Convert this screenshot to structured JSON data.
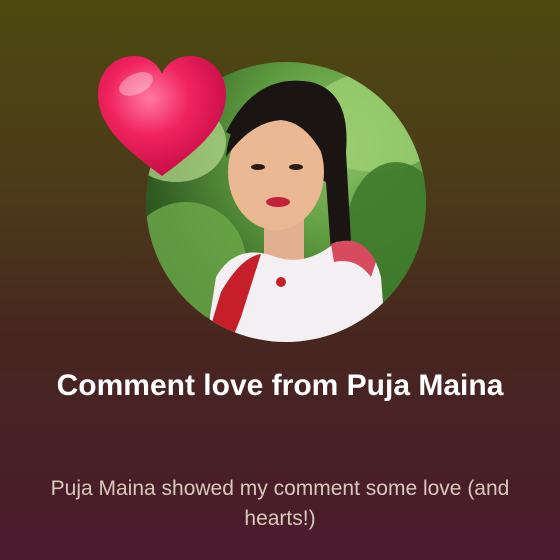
{
  "notification": {
    "title": "Comment love from Puja Maina",
    "message": "Puja Maina showed my comment some love (and hearts!)",
    "avatar": {
      "kind": "profile-photo",
      "subject": "woman"
    },
    "reaction_icon": "heart-icon"
  },
  "colors": {
    "background_top": "#4d4a10",
    "background_bottom": "#4a1a2e",
    "heart": "#e8195a",
    "title_text": "#ffffff",
    "message_text": "#d9c9b9"
  }
}
